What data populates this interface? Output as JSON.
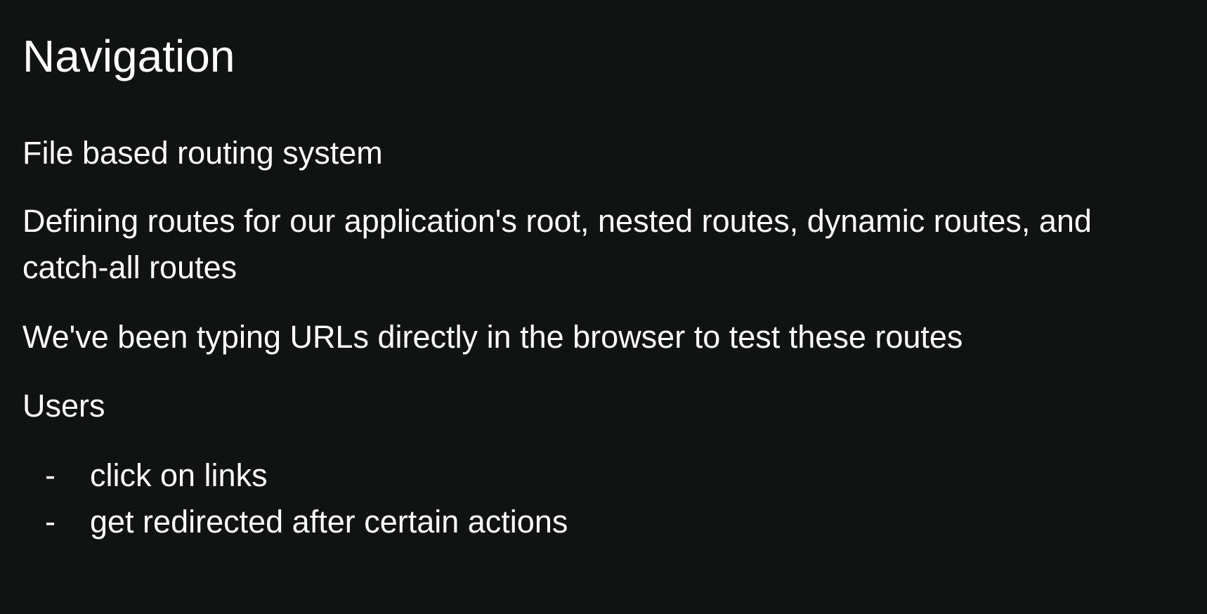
{
  "slide": {
    "title": "Navigation",
    "paragraphs": [
      "File based routing system",
      "Defining routes for our application's root, nested routes, dynamic routes, and",
      "catch-all routes",
      "We've been typing URLs directly in the browser to test these routes",
      "Users"
    ],
    "bullet_marker": "-",
    "bullets": [
      "click on links",
      "get redirected after certain actions"
    ]
  }
}
